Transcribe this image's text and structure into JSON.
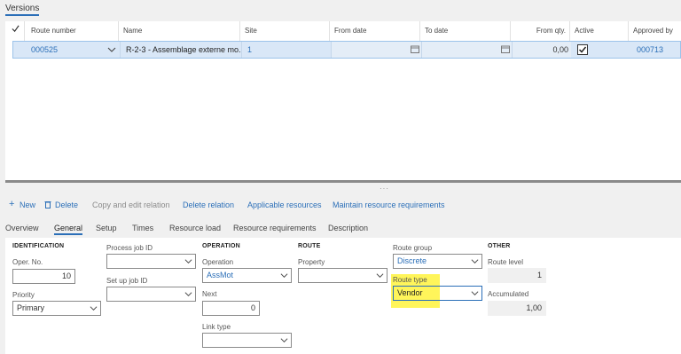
{
  "versions": {
    "tab_label": "Versions",
    "columns": [
      "Route number",
      "Name",
      "Site",
      "From date",
      "To date",
      "From qty.",
      "Active",
      "Approved by"
    ],
    "row": {
      "route_number": "000525",
      "name": "R-2-3 - Assemblage externe mo...",
      "site": "1",
      "from_date": "",
      "to_date": "",
      "from_qty": "0,00",
      "active": true,
      "approved_by": "000713"
    }
  },
  "actions": {
    "new": "New",
    "delete": "Delete",
    "copy_edit": "Copy and edit relation",
    "delete_relation": "Delete relation",
    "applicable_resources": "Applicable resources",
    "maintain_requirements": "Maintain resource requirements"
  },
  "tabs": [
    "Overview",
    "General",
    "Setup",
    "Times",
    "Resource load",
    "Resource requirements",
    "Description"
  ],
  "form": {
    "identification": {
      "header": "IDENTIFICATION",
      "oper_no_label": "Oper. No.",
      "oper_no": "10",
      "priority_label": "Priority",
      "priority": "Primary"
    },
    "jobs": {
      "process_job_label": "Process job ID",
      "process_job": "",
      "setup_job_label": "Set up job ID",
      "setup_job": ""
    },
    "operation": {
      "header": "OPERATION",
      "operation_label": "Operation",
      "operation": "AssMot",
      "next_label": "Next",
      "next": "0",
      "link_type_label": "Link type",
      "link_type": ""
    },
    "route": {
      "header": "ROUTE",
      "property_label": "Property",
      "property": "",
      "route_group_label": "Route group",
      "route_group": "Discrete",
      "route_type_label": "Route type",
      "route_type": "Vendor"
    },
    "other": {
      "header": "OTHER",
      "route_level_label": "Route level",
      "route_level": "1",
      "accumulated_label": "Accumulated",
      "accumulated": "1,00"
    }
  },
  "colors": {
    "accent": "#2b6fb8",
    "highlight": "#fff55a",
    "selected_row": "#d9e7f7"
  }
}
